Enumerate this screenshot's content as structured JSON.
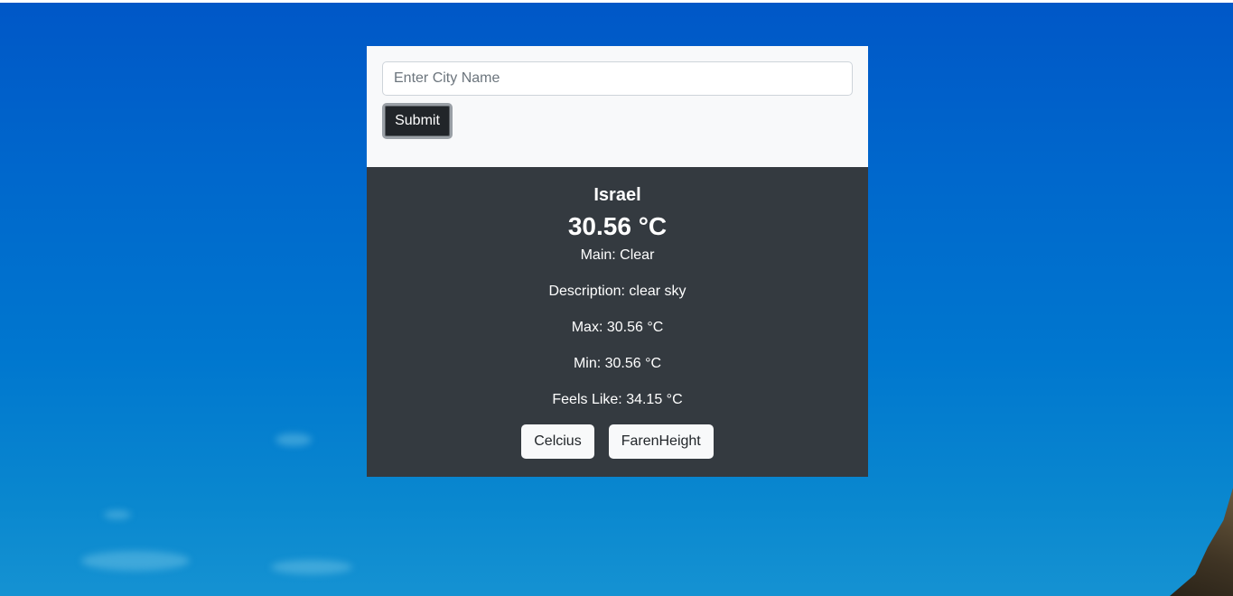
{
  "search": {
    "value": "",
    "placeholder": "Enter City Name",
    "submit_label": "Submit"
  },
  "weather": {
    "city": "Israel",
    "temperature": "30.56 °C",
    "main": "Main: Clear",
    "description": "Description: clear sky",
    "max": "Max: 30.56 °C",
    "min": "Min: 30.56 °C",
    "feels_like": "Feels Like: 34.15 °C"
  },
  "units": {
    "celsius_label": "Celcius",
    "fahrenheit_label": "FarenHeight"
  },
  "colors": {
    "form_background": "#f8f9fa",
    "result_background": "#343a40",
    "submit_background": "#212529",
    "page_background": "#0068cc"
  }
}
